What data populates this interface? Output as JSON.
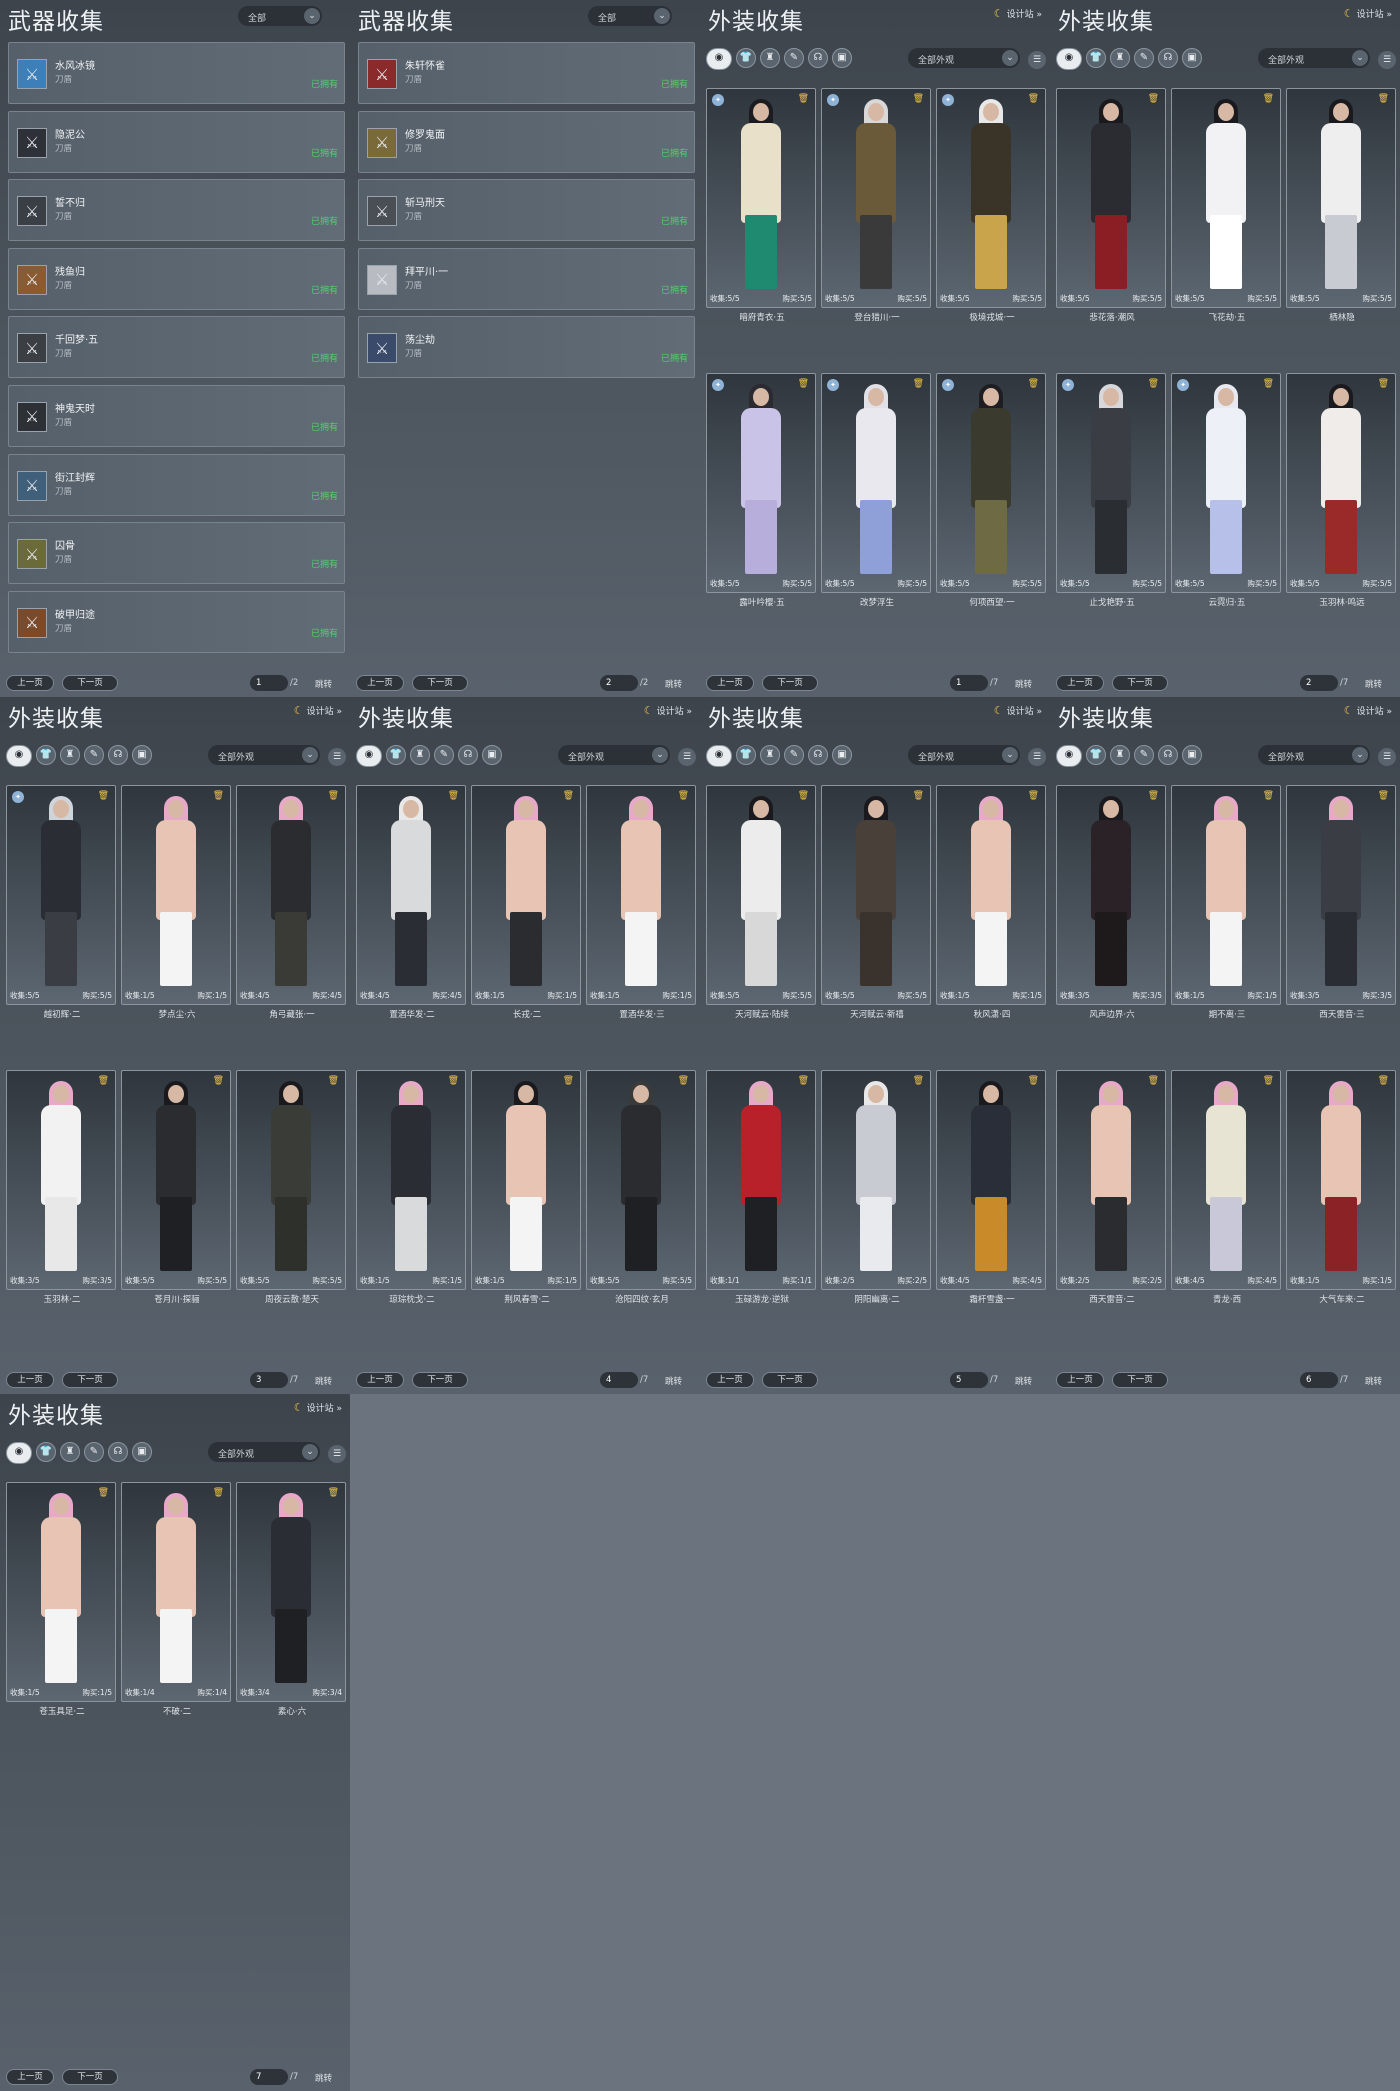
{
  "weapon_common": {
    "title": "武器收集",
    "filter": "全部",
    "type": "刀盾",
    "status": "已拥有"
  },
  "outfit_common": {
    "title": "外装收集",
    "filter": "全部外观",
    "design": "设计站",
    "collect_label": "收集:",
    "buy_label": "购买:"
  },
  "pager_common": {
    "prev": "上一页",
    "next": "下一页",
    "jump": "跳转"
  },
  "weapon_pages": [
    {
      "page": "1",
      "total": "/2",
      "items": [
        {
          "name": "水风冰镜",
          "icon": "sword-icon",
          "color": "#3d7fb8"
        },
        {
          "name": "隐泥公",
          "icon": "sword-icon",
          "color": "#2e3238"
        },
        {
          "name": "誓不归",
          "icon": "sword-icon",
          "color": "#3a3f46"
        },
        {
          "name": "残鱼归",
          "icon": "sword-icon",
          "color": "#8a5a32"
        },
        {
          "name": "千回梦·五",
          "icon": "sword-icon",
          "color": "#3b3f44"
        },
        {
          "name": "神鬼天时",
          "icon": "sword-icon",
          "color": "#2d3136"
        },
        {
          "name": "街江封辉",
          "icon": "sword-icon",
          "color": "#3f5f7a"
        },
        {
          "name": "囚骨",
          "icon": "sword-icon",
          "color": "#6b6a3a"
        },
        {
          "name": "破甲归途",
          "icon": "sword-icon",
          "color": "#7a4a2a"
        }
      ]
    },
    {
      "page": "2",
      "total": "/2",
      "items": [
        {
          "name": "朱轩怀雀",
          "icon": "sword-icon",
          "color": "#8a2a2a"
        },
        {
          "name": "修罗鬼面",
          "icon": "sword-icon",
          "color": "#7a6a3a"
        },
        {
          "name": "斩马刑天",
          "icon": "sword-icon",
          "color": "#4a4e55"
        },
        {
          "name": "拜平川·一",
          "icon": "sword-icon",
          "color": "#b8bcc2"
        },
        {
          "name": "荡尘劫",
          "icon": "sword-icon",
          "color": "#3a4a6a"
        }
      ]
    }
  ],
  "outfit_pages": [
    {
      "page": "1",
      "total": "/7",
      "items": [
        {
          "name": "暗府青衣·五",
          "collect": "5/5",
          "buy": "5/5",
          "top": "#e8e0c8",
          "bottom": "#1f8a70",
          "hair": "#1c1c20",
          "badge": true
        },
        {
          "name": "登台猎川·一",
          "collect": "5/5",
          "buy": "5/5",
          "top": "#6a5a3a",
          "bottom": "#3a3a3a",
          "hair": "#d8d8d8",
          "badge": true
        },
        {
          "name": "极境戎城·一",
          "collect": "5/5",
          "buy": "5/5",
          "top": "#3a3428",
          "bottom": "#c9a44a",
          "hair": "#e8e8e8",
          "badge": true
        },
        {
          "name": "露叶吟樱·五",
          "collect": "5/5",
          "buy": "5/5",
          "top": "#c9c3e8",
          "bottom": "#b7aedc",
          "hair": "#2a2a30",
          "badge": true
        },
        {
          "name": "改梦浮生",
          "collect": "5/5",
          "buy": "5/5",
          "top": "#e8e8ee",
          "bottom": "#8fa0d8",
          "hair": "#e0e0e6",
          "badge": true
        },
        {
          "name": "何项西望·一",
          "collect": "5/5",
          "buy": "5/5",
          "top": "#3a3a2e",
          "bottom": "#6e6a44",
          "hair": "#1e1e22",
          "badge": true
        }
      ]
    },
    {
      "page": "2",
      "total": "/7",
      "items": [
        {
          "name": "悲花落·潮风",
          "collect": "5/5",
          "buy": "5/5",
          "top": "#2b2b32",
          "bottom": "#8a1e24",
          "hair": "#1a1a1e",
          "badge": false
        },
        {
          "name": "飞花劫·五",
          "collect": "5/5",
          "buy": "5/5",
          "top": "#f2f2f4",
          "bottom": "#ffffff",
          "hair": "#1a1a1e",
          "badge": false
        },
        {
          "name": "栖林隐",
          "collect": "5/5",
          "buy": "5/5",
          "top": "#eeeeee",
          "bottom": "#c8ccd2",
          "hair": "#1a1a1e",
          "badge": false
        },
        {
          "name": "止戈艳野·五",
          "collect": "5/5",
          "buy": "5/5",
          "top": "#3a3e44",
          "bottom": "#2a2e33",
          "hair": "#d8d8dc",
          "badge": true
        },
        {
          "name": "云霓归·五",
          "collect": "5/5",
          "buy": "5/5",
          "top": "#eef0f8",
          "bottom": "#b7c0e8",
          "hair": "#e8e8f0",
          "badge": true
        },
        {
          "name": "玉羽林·鸣远",
          "collect": "5/5",
          "buy": "5/5",
          "top": "#f0ecea",
          "bottom": "#9a2a2a",
          "hair": "#1a1a1e",
          "badge": false
        }
      ]
    },
    {
      "page": "3",
      "total": "/7",
      "items": [
        {
          "name": "越初辉·二",
          "collect": "5/5",
          "buy": "5/5",
          "top": "#2a2e34",
          "bottom": "#3a3e44",
          "hair": "#cfd4da",
          "badge": true
        },
        {
          "name": "梦点尘·六",
          "collect": "1/5",
          "buy": "1/5",
          "top": "#e8c4b4",
          "bottom": "#f4f4f4",
          "hair": "#e8a8c8",
          "badge": false
        },
        {
          "name": "角弓藏张·一",
          "collect": "4/5",
          "buy": "4/5",
          "top": "#2a2c30",
          "bottom": "#3a3a36",
          "hair": "#e8a8c8",
          "badge": false
        },
        {
          "name": "玉羽林·二",
          "collect": "3/5",
          "buy": "3/5",
          "top": "#f2f2f2",
          "bottom": "#e8e8e8",
          "hair": "#e8a8c8",
          "badge": false
        },
        {
          "name": "苍月川·探骊",
          "collect": "5/5",
          "buy": "5/5",
          "top": "#2a2c30",
          "bottom": "#1e2024",
          "hair": "#1a1a1e",
          "badge": false
        },
        {
          "name": "周夜云散·楚天",
          "collect": "5/5",
          "buy": "5/5",
          "top": "#3a3c38",
          "bottom": "#2e302c",
          "hair": "#1a1a1e",
          "badge": false
        }
      ]
    },
    {
      "page": "4",
      "total": "/7",
      "items": [
        {
          "name": "置酒华发·二",
          "collect": "4/5",
          "buy": "4/5",
          "top": "#d8dadc",
          "bottom": "#2a2e34",
          "hair": "#e8e8e8",
          "badge": false
        },
        {
          "name": "长戎·二",
          "collect": "1/5",
          "buy": "1/5",
          "top": "#e8c4b4",
          "bottom": "#2a2c30",
          "hair": "#e8a8c8",
          "badge": false
        },
        {
          "name": "置酒华发·三",
          "collect": "1/5",
          "buy": "1/5",
          "top": "#e8c4b4",
          "bottom": "#f4f4f4",
          "hair": "#e8a8c8",
          "badge": false
        },
        {
          "name": "琼琮枕戈·二",
          "collect": "1/5",
          "buy": "1/5",
          "top": "#2a2e34",
          "bottom": "#d8dadc",
          "hair": "#e8a8c8",
          "badge": false
        },
        {
          "name": "荆风春雪·二",
          "collect": "1/5",
          "buy": "1/5",
          "top": "#e8c4b4",
          "bottom": "#f4f4f4",
          "hair": "#1a1a1e",
          "badge": false
        },
        {
          "name": "沧阳四纹·玄月",
          "collect": "5/5",
          "buy": "5/5",
          "top": "#2a2c30",
          "bottom": "#1e2024",
          "hair": "#3a3a3a",
          "badge": false
        }
      ]
    },
    {
      "page": "5",
      "total": "/7",
      "items": [
        {
          "name": "天河赋云·陆续",
          "collect": "5/5",
          "buy": "5/5",
          "top": "#ececec",
          "bottom": "#d8d8d8",
          "hair": "#1a1a1e",
          "badge": false
        },
        {
          "name": "天河赋云·新禧",
          "collect": "5/5",
          "buy": "5/5",
          "top": "#4a403a",
          "bottom": "#3a322c",
          "hair": "#1a1a1e",
          "badge": false
        },
        {
          "name": "秋风潇·四",
          "collect": "1/5",
          "buy": "1/5",
          "top": "#e8c4b4",
          "bottom": "#f4f4f4",
          "hair": "#e8a8c8",
          "badge": false
        },
        {
          "name": "玉碌游龙·逆狱",
          "collect": "1/1",
          "buy": "1/1",
          "top": "#b8202a",
          "bottom": "#1e2024",
          "hair": "#e8a8c8",
          "badge": false
        },
        {
          "name": "阴阳幽离·二",
          "collect": "2/5",
          "buy": "2/5",
          "top": "#c8ccd2",
          "bottom": "#e8eaee",
          "hair": "#e8e8e8",
          "badge": false
        },
        {
          "name": "霜杆雪盏·一",
          "collect": "4/5",
          "buy": "4/5",
          "top": "#2a2e38",
          "bottom": "#c98a2a",
          "hair": "#1a1a1e",
          "badge": false
        }
      ]
    },
    {
      "page": "6",
      "total": "/7",
      "items": [
        {
          "name": "风声边界·六",
          "collect": "3/5",
          "buy": "3/5",
          "top": "#2a2226",
          "bottom": "#1e1a1c",
          "hair": "#1a1a1e",
          "badge": false
        },
        {
          "name": "期不离·三",
          "collect": "1/5",
          "buy": "1/5",
          "top": "#e8c4b4",
          "bottom": "#f4f4f4",
          "hair": "#e8a8c8",
          "badge": false
        },
        {
          "name": "西天雷音·三",
          "collect": "3/5",
          "buy": "3/5",
          "top": "#3a3e44",
          "bottom": "#2a2e34",
          "hair": "#e8a8c8",
          "badge": false
        },
        {
          "name": "西天雷音·二",
          "collect": "2/5",
          "buy": "2/5",
          "top": "#e8c4b4",
          "bottom": "#2a2c30",
          "hair": "#e8a8c8",
          "badge": false
        },
        {
          "name": "青龙·西",
          "collect": "4/5",
          "buy": "4/5",
          "top": "#e8e4d4",
          "bottom": "#c8c8d8",
          "hair": "#e8a8c8",
          "badge": false
        },
        {
          "name": "大气车来·二",
          "collect": "1/5",
          "buy": "1/5",
          "top": "#e8c4b4",
          "bottom": "#8a2226",
          "hair": "#e8a8c8",
          "badge": false
        }
      ]
    },
    {
      "page": "7",
      "total": "/7",
      "items": [
        {
          "name": "苍玉具足·二",
          "collect": "1/5",
          "buy": "1/5",
          "top": "#e8c4b4",
          "bottom": "#f4f4f4",
          "hair": "#e8a8c8",
          "badge": false
        },
        {
          "name": "不破·二",
          "collect": "1/4",
          "buy": "1/4",
          "top": "#e8c4b4",
          "bottom": "#f4f4f4",
          "hair": "#e8a8c8",
          "badge": false
        },
        {
          "name": "素心·六",
          "collect": "3/4",
          "buy": "3/4",
          "top": "#2a2e34",
          "bottom": "#1e2024",
          "hair": "#e8a8c8",
          "badge": false
        }
      ]
    }
  ]
}
